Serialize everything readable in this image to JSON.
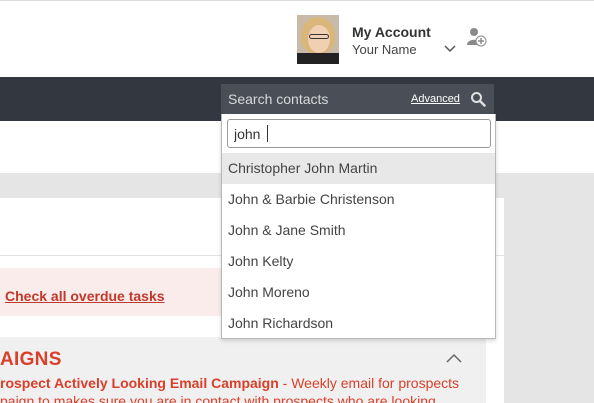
{
  "header": {
    "account_title": "My Account",
    "account_name": "Your Name"
  },
  "search": {
    "placeholder": "Search contacts",
    "advanced_label": "Advanced",
    "query": "john",
    "results": [
      "Christopher John Martin",
      "John & Barbie Christenson",
      "John & Jane Smith",
      "John Kelty",
      "John Moreno",
      "John Richardson"
    ]
  },
  "tasks": {
    "overdue_link": "Check all overdue tasks"
  },
  "campaigns": {
    "title": "AIGNS",
    "line1_name": "rospect Actively Looking Email Campaign",
    "line1_desc": " - Weekly email for prospects",
    "line2": "paign to makes sure you are in contact with prospects who are looking"
  },
  "colors": {
    "navbar": "#333840",
    "accent_red": "#d9402b"
  },
  "icons": [
    "chevron-down-icon",
    "add-user-icon",
    "search-icon",
    "chevron-up-icon"
  ]
}
